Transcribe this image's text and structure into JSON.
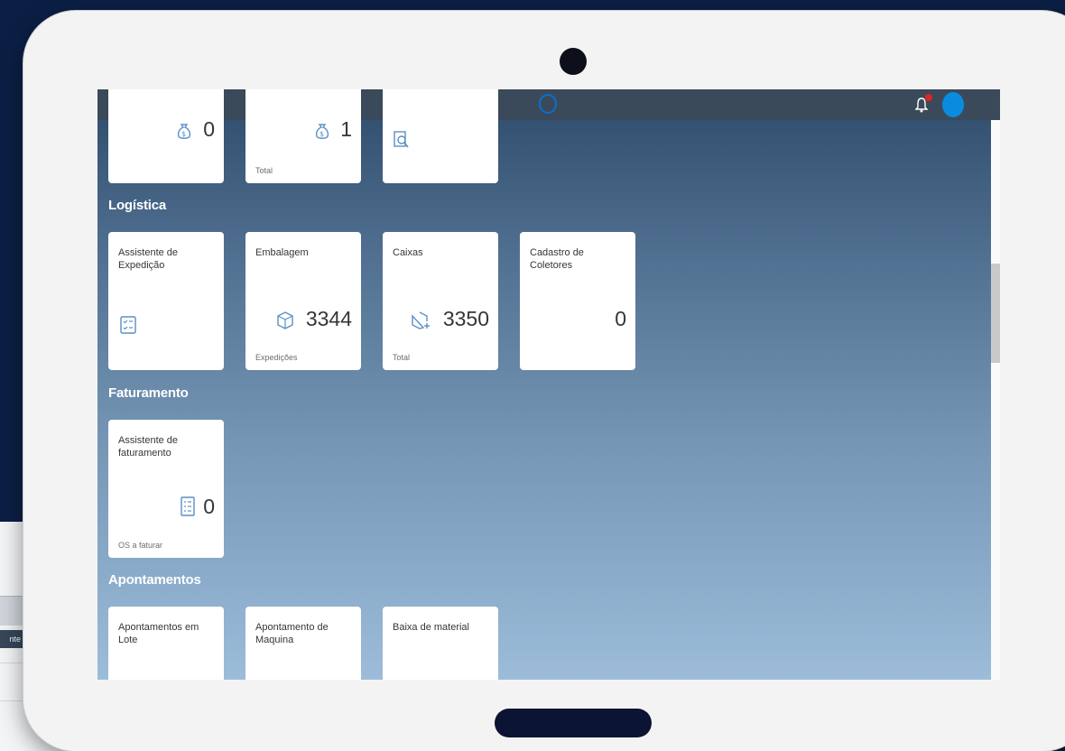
{
  "background_app": {
    "button_label": "nte"
  },
  "groups": {
    "logistica": "Logística",
    "faturamento": "Faturamento",
    "apontamentos": "Apontamentos"
  },
  "top_tiles": [
    {
      "value": "0",
      "subtitle": "",
      "icon": "money-bag-icon"
    },
    {
      "value": "1",
      "subtitle": "Total",
      "icon": "money-bag-icon"
    },
    {
      "value": "",
      "subtitle": "",
      "icon": "search-document-icon"
    }
  ],
  "logistica_tiles": [
    {
      "title": "Assistente de Expedição",
      "value": "",
      "subtitle": "",
      "icon": "checklist-icon"
    },
    {
      "title": "Embalagem",
      "value": "3344",
      "subtitle": "Expedições",
      "icon": "package-icon"
    },
    {
      "title": "Caixas",
      "value": "3350",
      "subtitle": "Total",
      "icon": "add-box-icon"
    },
    {
      "title": "Cadastro de Coletores",
      "value": "0",
      "subtitle": "",
      "icon": ""
    }
  ],
  "faturamento_tiles": [
    {
      "title": "Assistente de faturamento",
      "value": "0",
      "subtitle": "OS a faturar",
      "icon": "document-list-icon"
    }
  ],
  "apontamentos_tiles": [
    {
      "title": "Apontamentos em Lote"
    },
    {
      "title": "Apontamento de Maquina"
    },
    {
      "title": "Baixa de material"
    }
  ],
  "colors": {
    "shellbar": "#3b4a5a",
    "accent": "#0a6ed1",
    "icon_blue": "#5b8fc7",
    "notification": "#e02424",
    "tablet_frame": "#f3f3f3",
    "outer_background": "#0b1f45"
  }
}
